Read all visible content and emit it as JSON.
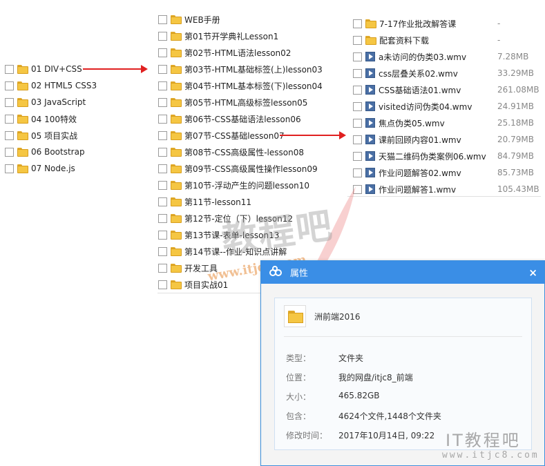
{
  "left_list": {
    "items": [
      {
        "label": "01 DIV+CSS"
      },
      {
        "label": "02 HTML5 CSS3"
      },
      {
        "label": "03 JavaScript"
      },
      {
        "label": "04 100特效"
      },
      {
        "label": "05 项目实战"
      },
      {
        "label": "06 Bootstrap"
      },
      {
        "label": "07 Node.js"
      }
    ]
  },
  "middle_list": {
    "items": [
      {
        "label": "WEB手册"
      },
      {
        "label": "第01节开学典礼Lesson1"
      },
      {
        "label": "第02节-HTML语法lesson02"
      },
      {
        "label": "第03节-HTML基础标签(上)lesson03"
      },
      {
        "label": "第04节-HTML基本标签(下)lesson04"
      },
      {
        "label": "第05节-HTML高级标签lesson05"
      },
      {
        "label": "第06节-CSS基础语法lesson06"
      },
      {
        "label": "第07节-CSS基础lesson07"
      },
      {
        "label": "第08节-CSS高级属性-lesson08"
      },
      {
        "label": "第09节-CSS高级属性操作lesson09"
      },
      {
        "label": "第10节-浮动产生的问题lesson10"
      },
      {
        "label": "第11节-lesson11"
      },
      {
        "label": "第12节-定位（下）lesson12"
      },
      {
        "label": "第13节课-表单-lesson13"
      },
      {
        "label": "第14节课--作业-知识点讲解"
      },
      {
        "label": "开发工具"
      },
      {
        "label": "项目实战01"
      }
    ]
  },
  "right_list": {
    "items": [
      {
        "label": "7-17作业批改解答课",
        "size": "-",
        "kind": "folder"
      },
      {
        "label": "配套资料下载",
        "size": "-",
        "kind": "folder"
      },
      {
        "label": "a未访问的伪类03.wmv",
        "size": "7.28MB",
        "kind": "video"
      },
      {
        "label": "css层叠关系02.wmv",
        "size": "33.29MB",
        "kind": "video"
      },
      {
        "label": "CSS基础语法01.wmv",
        "size": "261.08MB",
        "kind": "video"
      },
      {
        "label": "visited访问伪类04.wmv",
        "size": "24.91MB",
        "kind": "video"
      },
      {
        "label": "焦点伪类05.wmv",
        "size": "25.18MB",
        "kind": "video"
      },
      {
        "label": "课前回顾内容01.wmv",
        "size": "20.79MB",
        "kind": "video"
      },
      {
        "label": "天猫二维码伪类案例06.wmv",
        "size": "84.79MB",
        "kind": "video"
      },
      {
        "label": "作业问题解答02.wmv",
        "size": "85.73MB",
        "kind": "video"
      },
      {
        "label": "作业问题解答1.wmv",
        "size": "105.43MB",
        "kind": "video"
      }
    ]
  },
  "dialog": {
    "title": "属性",
    "close": "×",
    "file_name": "洲前端2016",
    "props": [
      {
        "key": "类型：",
        "value": "文件夹"
      },
      {
        "key": "位置：",
        "value": "我的网盘/itjc8_前端"
      },
      {
        "key": "大小：",
        "value": "465.82GB"
      },
      {
        "key": "包含：",
        "value": "4624个文件,1448个文件夹"
      },
      {
        "key": "修改时间：",
        "value": "2017年10月14日, 09:22"
      }
    ]
  },
  "watermark": {
    "brand": "IT教程吧",
    "url": "www.itjc8.com",
    "url_corner": "www.itjc8.com",
    "center_glyphs": "教程吧",
    "center_url": "www.itjc8.com"
  },
  "colors": {
    "arrow": "#e02020",
    "dialog_title_bar": "#3a8ee6",
    "folder": "#f5c643",
    "video_icon": "#4a6fa5"
  }
}
